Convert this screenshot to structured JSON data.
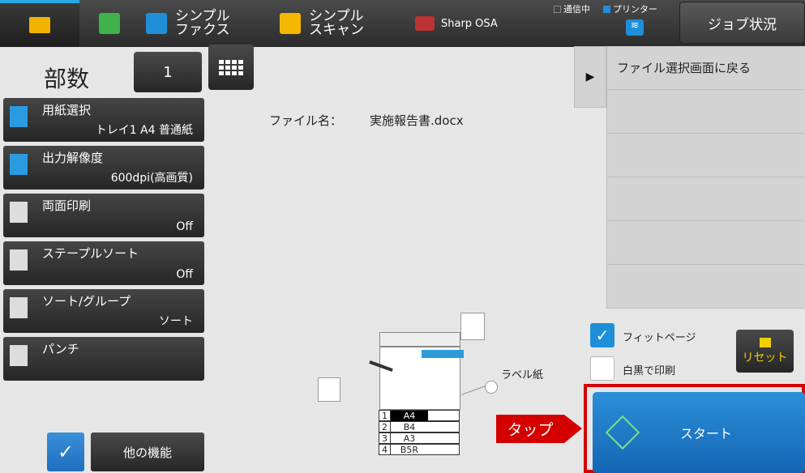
{
  "topbar": {
    "apps": [
      {
        "label": "",
        "icon": "copy-app-icon"
      },
      {
        "label": "シンプル\nファクス",
        "icon": "fax-icon"
      },
      {
        "label": "シンプル\nスキャン",
        "icon": "scan-icon"
      },
      {
        "label": "Sharp OSA",
        "icon": "osa-icon"
      }
    ],
    "status_comm": "通信中",
    "status_printer": "プリンター",
    "job_status": "ジョブ状況"
  },
  "copies": {
    "label": "部数",
    "value": "1"
  },
  "menu": [
    {
      "title": "用紙選択",
      "value": "トレイ1 A4 普通紙",
      "icon": "paper-select-icon"
    },
    {
      "title": "出力解像度",
      "value": "600dpi(高画質)",
      "icon": "resolution-icon"
    },
    {
      "title": "両面印刷",
      "value": "Off",
      "icon": "duplex-icon"
    },
    {
      "title": "ステープルソート",
      "value": "Off",
      "icon": "staple-icon"
    },
    {
      "title": "ソート/グループ",
      "value": "ソート",
      "icon": "sort-icon"
    },
    {
      "title": "パンチ",
      "value": "",
      "icon": "punch-icon"
    }
  ],
  "file": {
    "label": "ファイル名：",
    "name": "実施報告書.docx"
  },
  "right_panel": {
    "back": "ファイル選択画面に戻る"
  },
  "options": {
    "fit_page": "フィットページ",
    "bw_print": "白黒で印刷"
  },
  "reset": "リセット",
  "start": "スタート",
  "tap": "タップ",
  "other_functions": "他の機能",
  "illustration": {
    "label_paper": "ラベル紙",
    "trays": [
      {
        "n": "1",
        "size": "A4"
      },
      {
        "n": "2",
        "size": "B4"
      },
      {
        "n": "3",
        "size": "A3"
      },
      {
        "n": "4",
        "size": "B5R"
      }
    ]
  },
  "colors": {
    "accent": "#1e8fd8",
    "highlight": "#d40000"
  }
}
